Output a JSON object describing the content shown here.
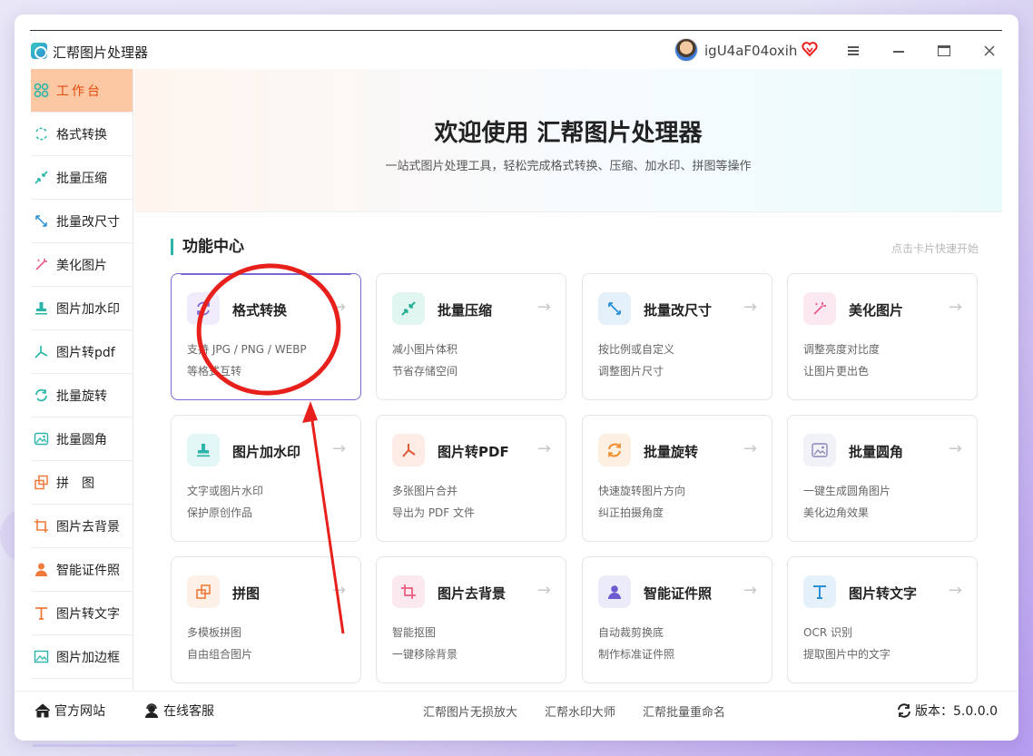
{
  "app": {
    "title": "汇帮图片处理器",
    "username": "igU4aF04oxih"
  },
  "sidebar": {
    "items": [
      {
        "label": "工作台",
        "icon": "grid-icon"
      },
      {
        "label": "格式转换",
        "icon": "convert-icon"
      },
      {
        "label": "批量压缩",
        "icon": "compress-icon"
      },
      {
        "label": "批量改尺寸",
        "icon": "resize-icon"
      },
      {
        "label": "美化图片",
        "icon": "magic-wand-icon"
      },
      {
        "label": "图片加水印",
        "icon": "stamp-icon"
      },
      {
        "label": "图片转pdf",
        "icon": "pdf-icon"
      },
      {
        "label": "批量旋转",
        "icon": "rotate-icon"
      },
      {
        "label": "批量圆角",
        "icon": "image-icon"
      },
      {
        "label": "拼　图",
        "icon": "puzzle-icon"
      },
      {
        "label": "图片去背景",
        "icon": "crop-icon"
      },
      {
        "label": "智能证件照",
        "icon": "person-icon"
      },
      {
        "label": "图片转文字",
        "icon": "text-icon"
      },
      {
        "label": "图片加边框",
        "icon": "frame-icon"
      }
    ]
  },
  "hero": {
    "title": "欢迎使用 汇帮图片处理器",
    "subtitle": "一站式图片处理工具，轻松完成格式转换、压缩、加水印、拼图等操作"
  },
  "section": {
    "title": "功能中心",
    "hint": "点击卡片快速开始"
  },
  "cards": [
    {
      "title": "格式转换",
      "line1": "支持 JPG / PNG / WEBP",
      "line2": "等格式互转",
      "arrow": "→"
    },
    {
      "title": "批量压缩",
      "line1": "减小图片体积",
      "line2": "节省存储空间",
      "arrow": "→"
    },
    {
      "title": "批量改尺寸",
      "line1": "按比例或自定义",
      "line2": "调整图片尺寸",
      "arrow": "→"
    },
    {
      "title": "美化图片",
      "line1": "调整亮度对比度",
      "line2": "让图片更出色",
      "arrow": "→"
    },
    {
      "title": "图片加水印",
      "line1": "文字或图片水印",
      "line2": "保护原创作品",
      "arrow": "→"
    },
    {
      "title": "图片转PDF",
      "line1": "多张图片合并",
      "line2": "导出为 PDF 文件",
      "arrow": "→"
    },
    {
      "title": "批量旋转",
      "line1": "快速旋转图片方向",
      "line2": "纠正拍摄角度",
      "arrow": "→"
    },
    {
      "title": "批量圆角",
      "line1": "一键生成圆角图片",
      "line2": "美化边角效果",
      "arrow": "→"
    },
    {
      "title": "拼图",
      "line1": "多模板拼图",
      "line2": "自由组合图片",
      "arrow": "→"
    },
    {
      "title": "图片去背景",
      "line1": "智能抠图",
      "line2": "一键移除背景",
      "arrow": "→"
    },
    {
      "title": "智能证件照",
      "line1": "自动裁剪换底",
      "line2": "制作标准证件照",
      "arrow": "→"
    },
    {
      "title": "图片转文字",
      "line1": "OCR 识别",
      "line2": "提取图片中的文字",
      "arrow": "→"
    }
  ],
  "footer": {
    "website": "官方网站",
    "support": "在线客服",
    "links": [
      "汇帮图片无损放大",
      "汇帮水印大师",
      "汇帮批量重命名"
    ],
    "version": "版本：5.0.0.0"
  },
  "colors": {
    "accent": "#2ab5a8",
    "active_sidebar": "#fbc8a3",
    "active_text": "#e24a10",
    "selected_card": "#7b68d6",
    "annotation": "#e8201c"
  }
}
